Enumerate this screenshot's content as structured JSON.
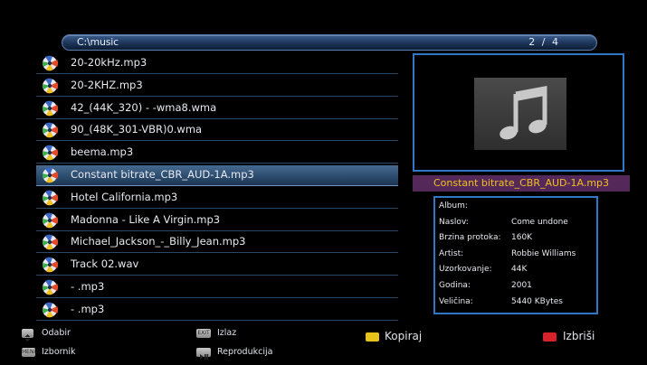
{
  "path_bar": {
    "path": "C:\\music",
    "page": "2 / 4"
  },
  "files": [
    {
      "name": "20-20kHz.mp3",
      "selected": false
    },
    {
      "name": "20-2KHZ.mp3",
      "selected": false
    },
    {
      "name": "42_(44K_320)  - -wma8.wma",
      "selected": false
    },
    {
      "name": "90_(48K_301-VBR)0.wma",
      "selected": false
    },
    {
      "name": "beema.mp3",
      "selected": false
    },
    {
      "name": "Constant bitrate_CBR_AUD-1A.mp3",
      "selected": true
    },
    {
      "name": "Hotel California.mp3",
      "selected": false
    },
    {
      "name": "Madonna - Like A Virgin.mp3",
      "selected": false
    },
    {
      "name": "Michael_Jackson_-_Billy_Jean.mp3",
      "selected": false
    },
    {
      "name": "Track 02.wav",
      "selected": false
    },
    {
      "name": " - .mp3",
      "selected": false
    },
    {
      "name": " - .mp3",
      "selected": false
    }
  ],
  "selected_title": "Constant bitrate_CBR_AUD-1A.mp3",
  "info": [
    {
      "label": "Album:",
      "value": ""
    },
    {
      "label": "Naslov:",
      "value": "Come undone"
    },
    {
      "label": "Brzina protoka:",
      "value": "160K"
    },
    {
      "label": "Artist:",
      "value": "Robbie Williams"
    },
    {
      "label": "Uzorkovanje:",
      "value": "44K"
    },
    {
      "label": "Godina:",
      "value": "2001"
    },
    {
      "label": "Veličina:",
      "value": "5440 KBytes"
    }
  ],
  "footer": {
    "odabir": "Odabir",
    "izbornik": "Izbornik",
    "izbornik_key": "MENU",
    "izlaz": "Izlaz",
    "izlaz_key": "EXIT",
    "reprodukcija": "Reprodukcija",
    "kopiraj": "Kopiraj",
    "izbrisi": "Izbriši"
  },
  "colors": {
    "accent_blue": "#2f78c8",
    "selected_title_bg": "#55285a",
    "selected_title_text": "#f0c020",
    "key_yellow": "#e6c21a",
    "key_red": "#d6232a"
  },
  "icons": {
    "file": "music-file-icon",
    "preview": "music-note-icon",
    "updown": "up-down-arrows-icon",
    "play": "play-pause-icon"
  }
}
